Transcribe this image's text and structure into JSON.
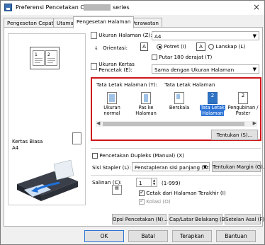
{
  "window": {
    "title_prefix": "Preferensi Pencetakan Canon",
    "title_suffix": "series",
    "close_icon": "×"
  },
  "tabs": [
    {
      "label": "Pengesetan Cepat"
    },
    {
      "label": "Utama"
    },
    {
      "label": "Pengesetan Halaman"
    },
    {
      "label": "Perawatan"
    }
  ],
  "preview": {
    "sheet1": "1",
    "sheet2": "2",
    "paper_type": "Kertas Biasa",
    "paper_size": "A4"
  },
  "page_setup": {
    "page_size_label": "Ukuran Halaman (Z):",
    "page_size_value": "A4",
    "orientation_label": "Orientasi:",
    "portrait_label": "Potret (I)",
    "landscape_label": "Lanskap (L)",
    "orientation_icon": "A",
    "rotate_label": "Putar 180 derajat (T)",
    "printer_paper_label_1": "Ukuran Kertas",
    "printer_paper_label_2": "Pencetak (E):",
    "printer_paper_value": "Sama dengan Ukuran Halaman"
  },
  "layout": {
    "header_label": "Tata Letak Halaman (Y):",
    "header_value": "Tata Letak Halaman",
    "items": [
      {
        "label_1": "Ukuran normal",
        "label_2": ""
      },
      {
        "label_1": "Pas ke",
        "label_2": "Halaman"
      },
      {
        "label_1": "Berskala",
        "label_2": ""
      },
      {
        "label_1": "Tata Letak",
        "label_2": "Halaman",
        "icon_text": "2"
      },
      {
        "label_1": "Pengubinan /",
        "label_2": "Poster",
        "icon_text": "2"
      }
    ],
    "specify_button": "Tentukan (S)..."
  },
  "duplex": {
    "label": "Pencetakan Dupleks (Manual) (X)",
    "stapling_label": "Sisi Stapler (L):",
    "stapling_value": "Penstapleran sisi panjang (Atas)",
    "margin_button": "Tentukan Margin (G)..."
  },
  "copies": {
    "label": "Salinan (C):",
    "value": "1",
    "range": "(1-999)",
    "last_page_label": "Cetak dari Halaman Terakhir (I)",
    "collate_label": "Kolasi (O)"
  },
  "option_buttons": {
    "print_options": "Opsi Pencetakan (N)...",
    "stamp_background": "Cap/Latar Belakang (B)...",
    "defaults": "Setelan Asal (F)"
  },
  "dialog_buttons": {
    "ok": "OK",
    "cancel": "Batal",
    "apply": "Terapkan",
    "help": "Bantuan"
  },
  "colors": {
    "highlight_border": "#d0161b",
    "selection": "#2d74d6"
  }
}
